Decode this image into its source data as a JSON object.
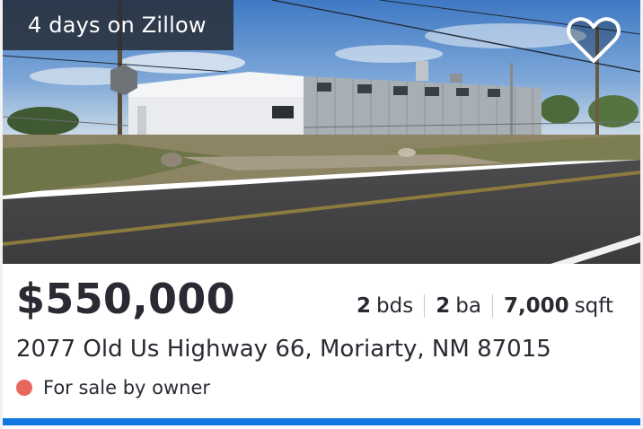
{
  "listing": {
    "days_on_site": "4 days on Zillow",
    "price": "$550,000",
    "beds_num": "2",
    "beds_unit": "bds",
    "baths_num": "2",
    "baths_unit": "ba",
    "sqft_num": "7,000",
    "sqft_unit": "sqft",
    "address": "2077 Old Us Highway 66, Moriarty, NM 87015",
    "status_text": "For sale by owner"
  },
  "icons": {
    "save": "heart-outline-icon",
    "status": "status-dot-icon"
  },
  "colors": {
    "status_dot": "#e8675d",
    "accent_bar": "#1277e1",
    "text": "#2a2a33",
    "badge_bg": "#282e38"
  }
}
